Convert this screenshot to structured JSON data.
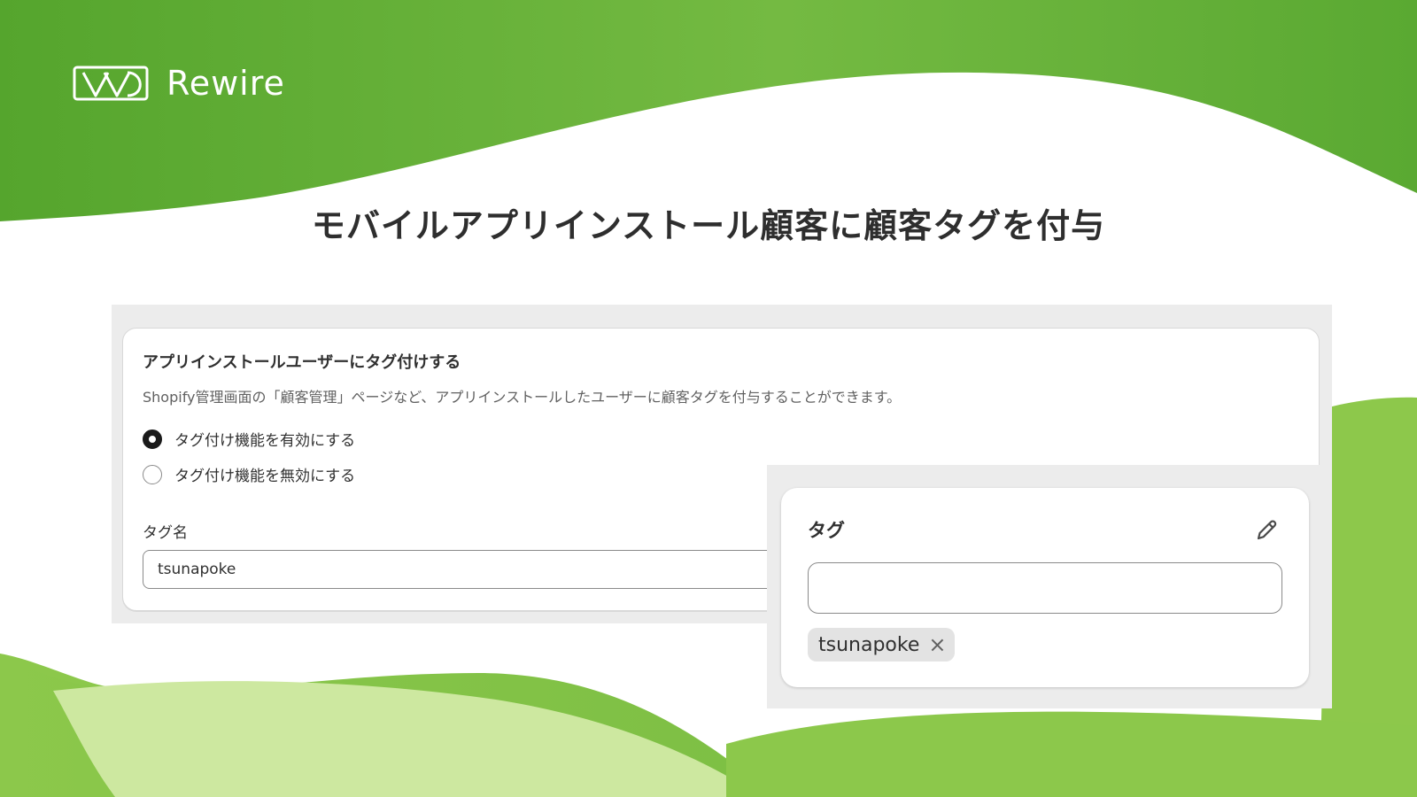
{
  "brand": {
    "name": "Rewire",
    "logo_icon": "rewire-logo-icon"
  },
  "headline": "モバイルアプリインストール顧客に顧客タグを付与",
  "settings_card": {
    "title": "アプリインストールユーザーにタグ付けする",
    "description": "Shopify管理画面の「顧客管理」ページなど、アプリインストールしたユーザーに顧客タグを付与することができます。",
    "options": [
      {
        "label": "タグ付け機能を有効にする",
        "selected": true
      },
      {
        "label": "タグ付け機能を無効にする",
        "selected": false
      }
    ],
    "tag_name_label": "タグ名",
    "tag_name_value": "tsunapoke"
  },
  "tag_card": {
    "title": "タグ",
    "edit_icon": "pencil-icon",
    "input_value": "",
    "tags": [
      {
        "label": "tsunapoke",
        "remove_icon": "close-icon"
      }
    ]
  },
  "colors": {
    "brand_green": "#62b233",
    "light_green": "#cde8a0",
    "text_dark": "#303030",
    "text_muted": "#616161"
  }
}
